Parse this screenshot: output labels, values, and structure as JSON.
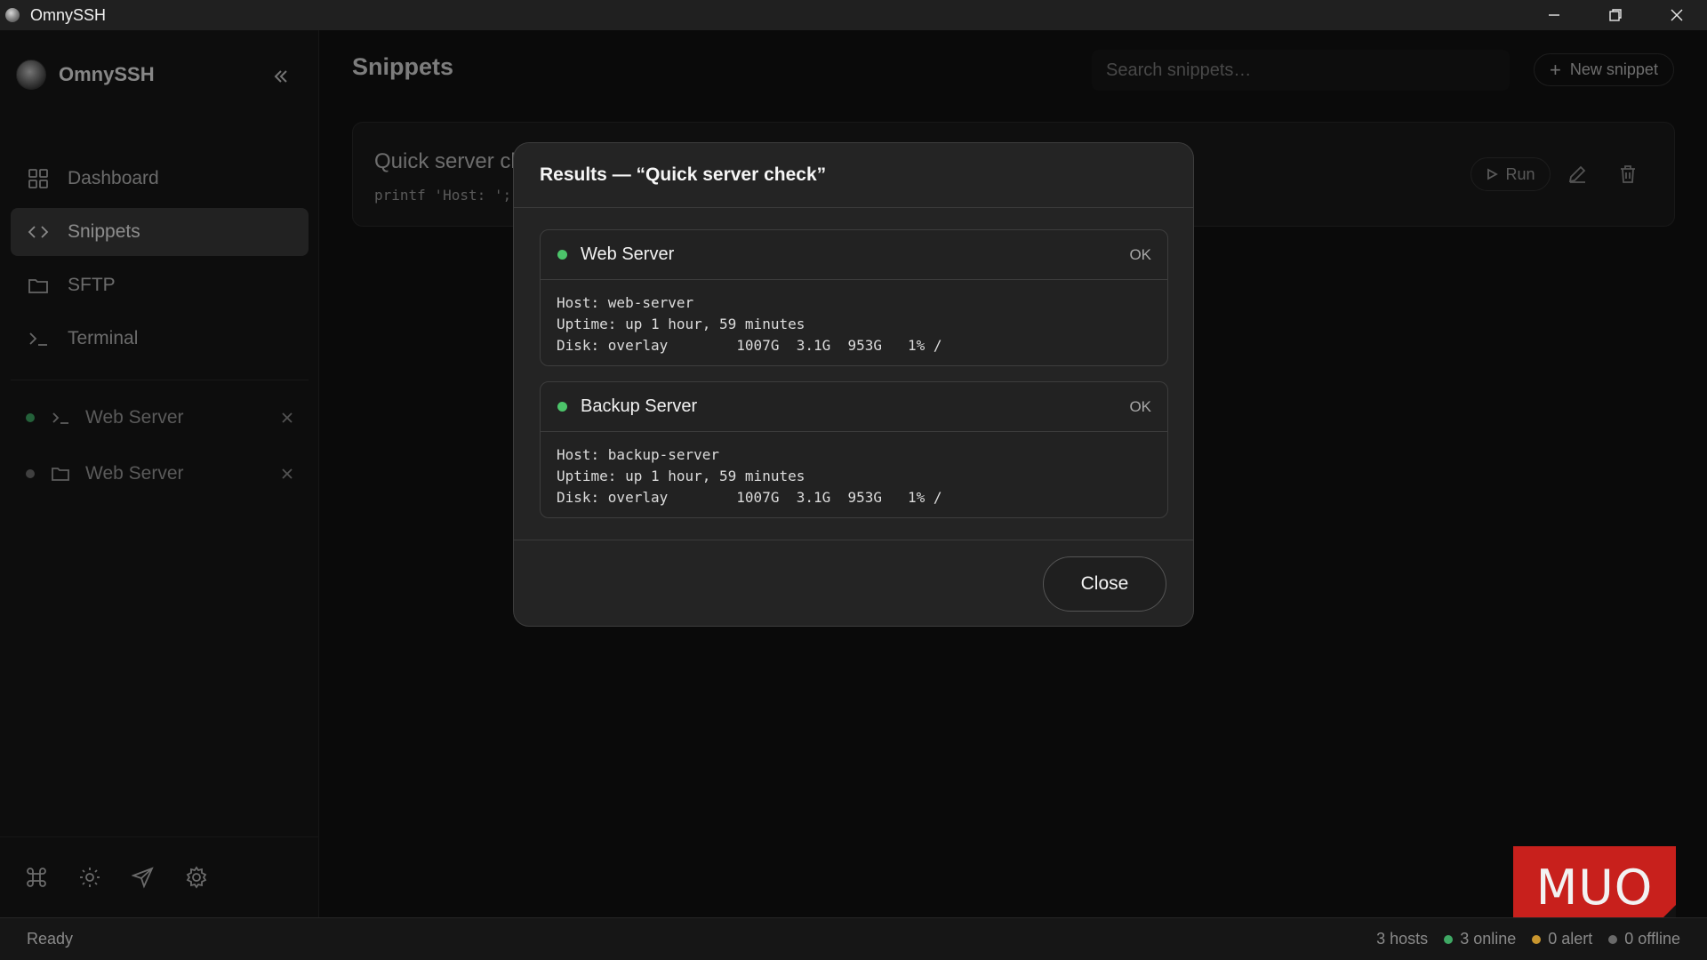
{
  "window": {
    "title": "OmnySSH",
    "icons": {
      "minimize": "minimize-icon",
      "restore": "restore-icon",
      "close": "close-icon"
    }
  },
  "sidebar": {
    "brand": "OmnySSH",
    "nav": [
      {
        "label": "Dashboard",
        "icon": "grid-icon"
      },
      {
        "label": "Snippets",
        "icon": "code-icon",
        "active": true
      },
      {
        "label": "SFTP",
        "icon": "folder-icon"
      },
      {
        "label": "Terminal",
        "icon": "terminal-icon"
      }
    ],
    "sessions": [
      {
        "label": "Web Server",
        "type": "terminal",
        "status_color": "#3fa864"
      },
      {
        "label": "Web Server",
        "type": "sftp",
        "status_color": "#6e6e6e"
      }
    ],
    "footer_icons": [
      "command-icon",
      "theme-icon",
      "send-icon",
      "settings-icon"
    ]
  },
  "main": {
    "title": "Snippets",
    "search_placeholder": "Search snippets…",
    "new_snippet_label": "New snippet",
    "snippet": {
      "name": "Quick server check",
      "command_preview": "printf 'Host: ';",
      "run_label": "Run"
    }
  },
  "modal": {
    "title": "Results — “Quick server check”",
    "results": [
      {
        "host": "Web Server",
        "status": "OK",
        "status_color": "#4cc46a",
        "output": "Host: web-server\nUptime: up 1 hour, 59 minutes\nDisk: overlay        1007G  3.1G  953G   1% /"
      },
      {
        "host": "Backup Server",
        "status": "OK",
        "status_color": "#4cc46a",
        "output": "Host: backup-server\nUptime: up 1 hour, 59 minutes\nDisk: overlay        1007G  3.1G  953G   1% /"
      }
    ],
    "close_label": "Close"
  },
  "statusbar": {
    "left": "Ready",
    "hosts": "3 hosts",
    "online": "3 online",
    "alert": "0 alert",
    "offline": "0 offline",
    "colors": {
      "online": "#3fa864",
      "alert": "#c9962e",
      "offline": "#6a6a6a"
    }
  },
  "watermark": "MUO",
  "colors": {
    "accent_active": "#3b3b3b",
    "background": "#121212"
  }
}
